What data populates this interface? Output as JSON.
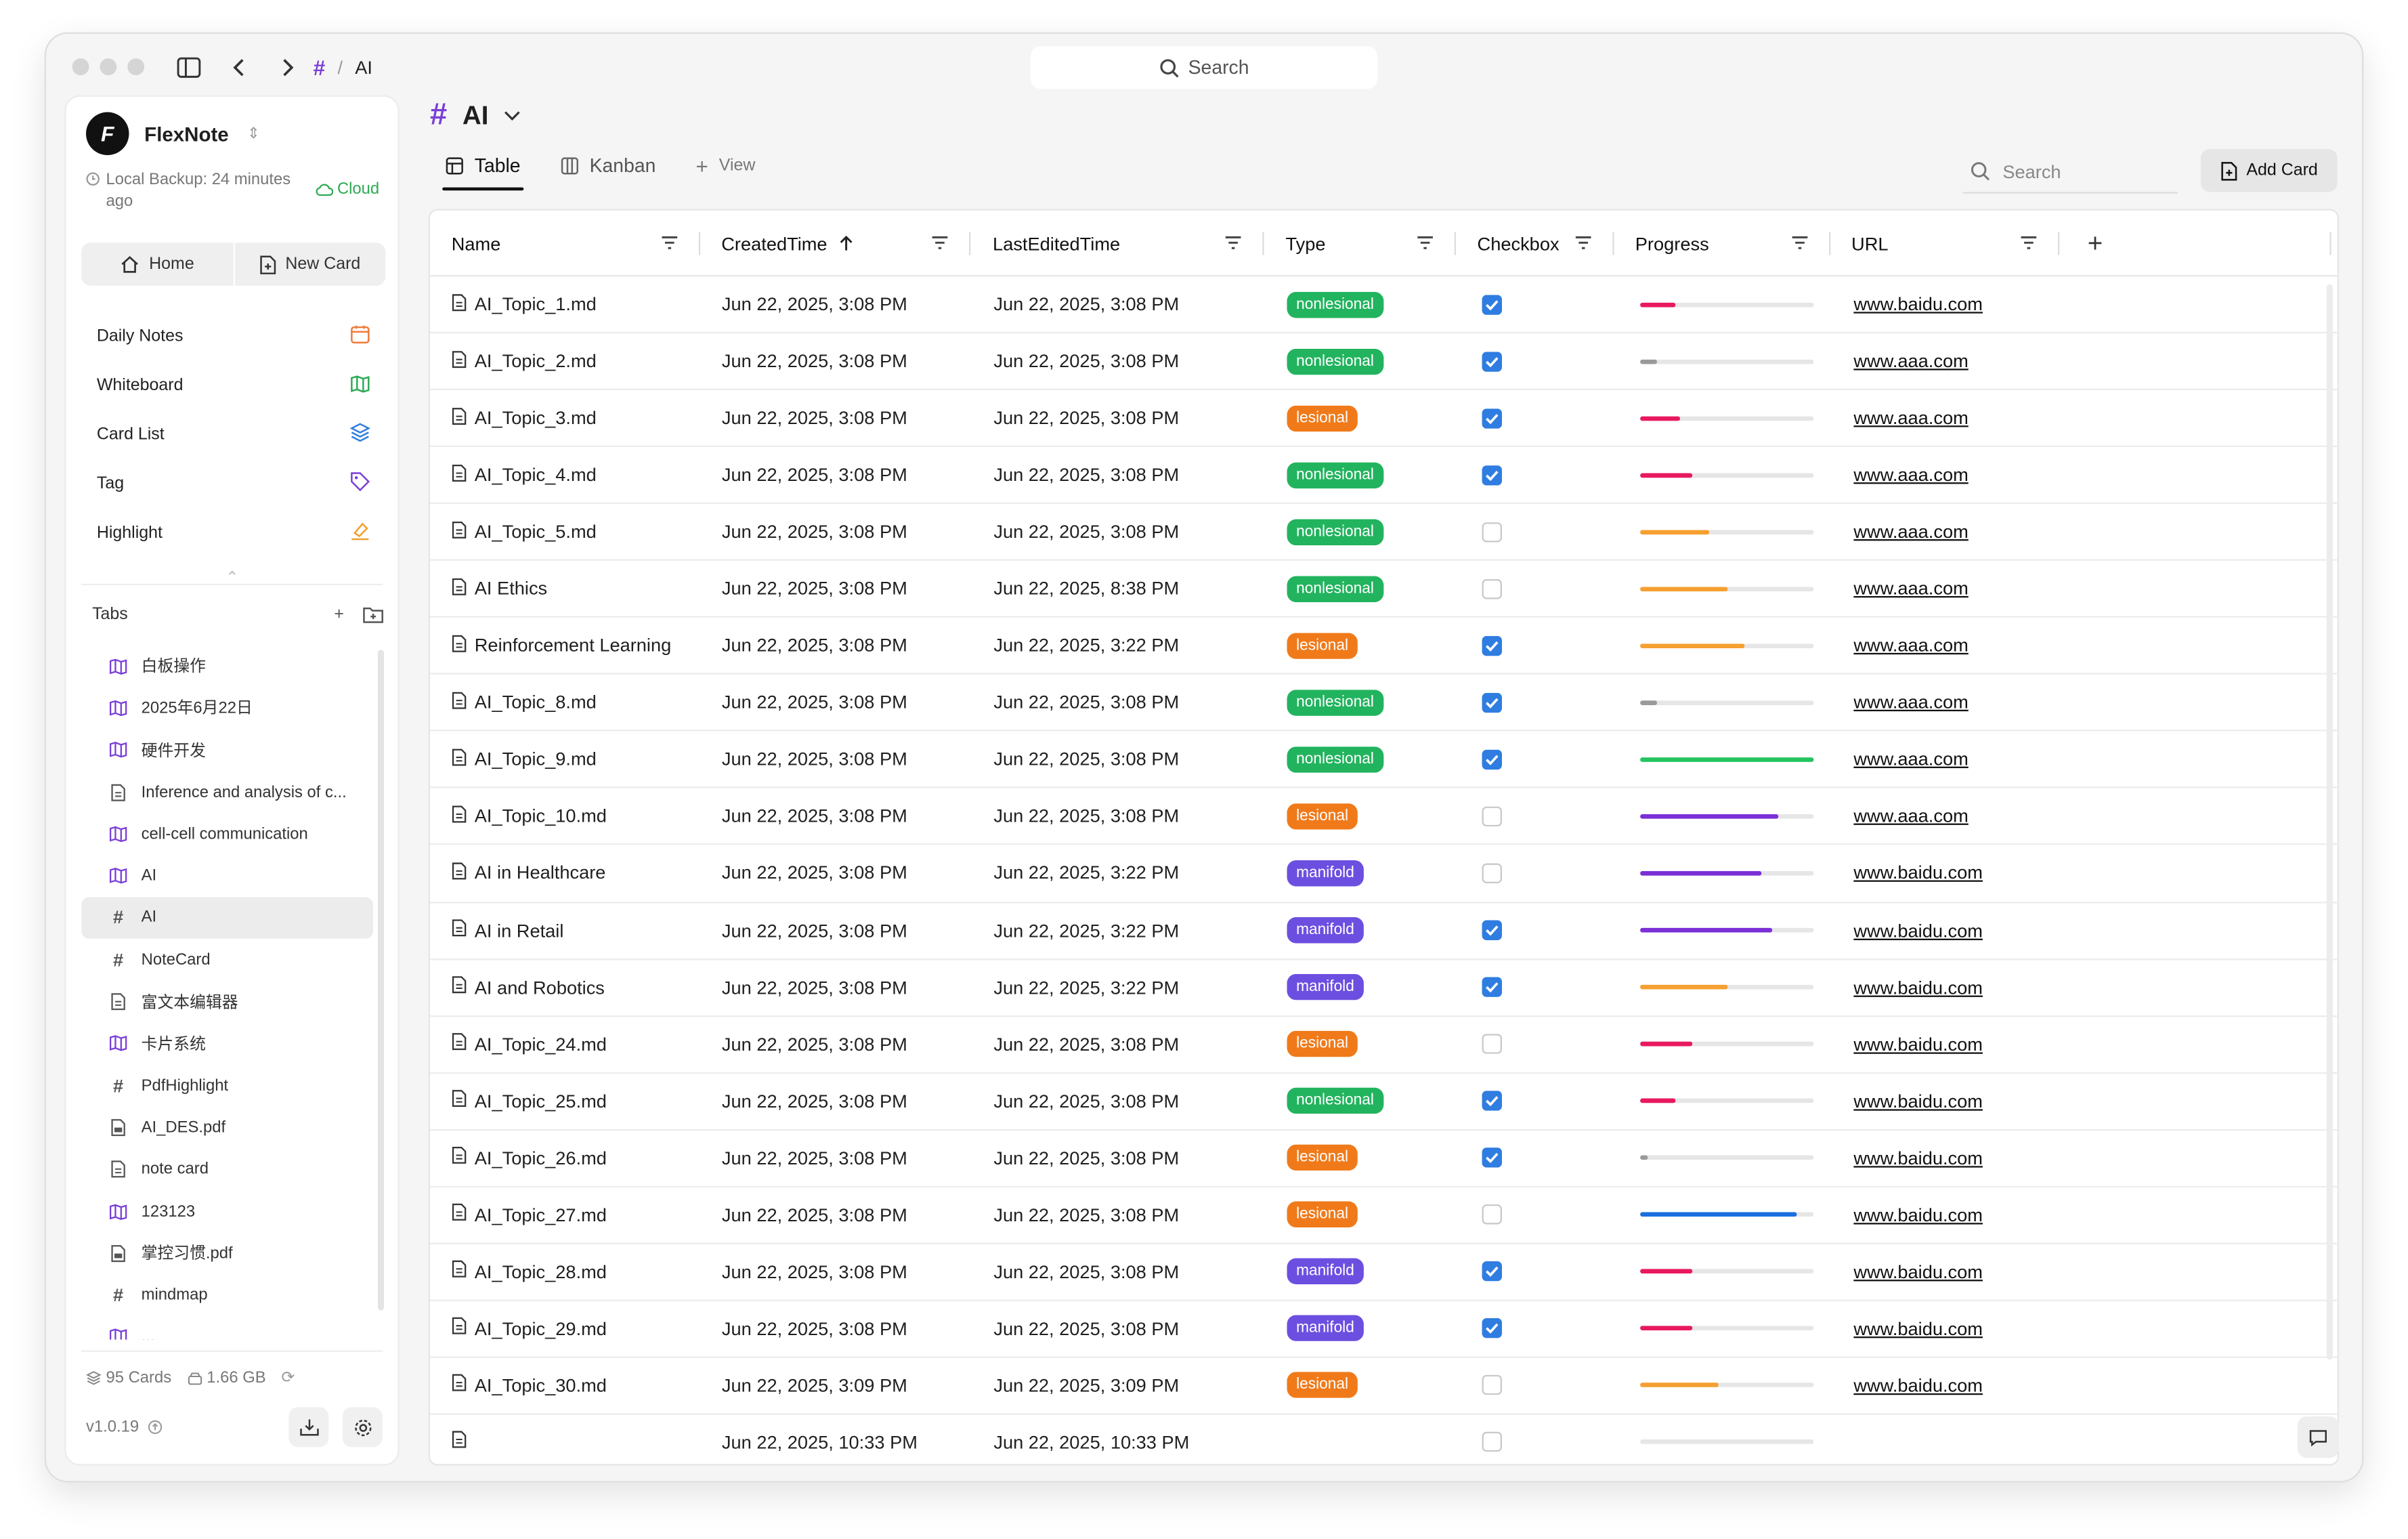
{
  "titlebar": {
    "breadcrumb_hash": "#",
    "breadcrumb_sep": "/",
    "breadcrumb_current": "AI",
    "search_placeholder": "Search"
  },
  "sidebar": {
    "brand": "FlexNote",
    "backup_text": "Local Backup: 24 minutes ago",
    "cloud_label": "Cloud",
    "home_label": "Home",
    "new_card_label": "New Card",
    "nav": [
      {
        "label": "Daily Notes",
        "icon": "calendar-icon",
        "color": "#f07a3a"
      },
      {
        "label": "Whiteboard",
        "icon": "map-icon",
        "color": "#2eaa55"
      },
      {
        "label": "Card List",
        "icon": "layers-icon",
        "color": "#2f7de1"
      },
      {
        "label": "Tag",
        "icon": "tag-icon",
        "color": "#7b3fd6"
      },
      {
        "label": "Highlight",
        "icon": "highlighter-icon",
        "color": "#f0a030"
      }
    ],
    "tabs_label": "Tabs",
    "tabs": [
      {
        "label": "白板操作",
        "icon": "map-icon"
      },
      {
        "label": "2025年6月22日",
        "icon": "map-icon"
      },
      {
        "label": "硬件开发",
        "icon": "map-icon"
      },
      {
        "label": "Inference and analysis of c...",
        "icon": "doc-icon"
      },
      {
        "label": "cell-cell communication",
        "icon": "map-icon"
      },
      {
        "label": "AI",
        "icon": "map-icon"
      },
      {
        "label": "AI",
        "icon": "hash-icon",
        "active": true
      },
      {
        "label": "NoteCard",
        "icon": "hash-icon"
      },
      {
        "label": "富文本编辑器",
        "icon": "doc-icon"
      },
      {
        "label": "卡片系统",
        "icon": "map-icon"
      },
      {
        "label": "PdfHighlight",
        "icon": "hash-icon"
      },
      {
        "label": "AI_DES.pdf",
        "icon": "pdf-icon"
      },
      {
        "label": "note card",
        "icon": "doc-icon"
      },
      {
        "label": "123123",
        "icon": "map-icon"
      },
      {
        "label": "掌控习惯.pdf",
        "icon": "pdf-icon"
      },
      {
        "label": "mindmap",
        "icon": "hash-icon"
      },
      {
        "label": "...",
        "icon": "map-icon"
      }
    ],
    "cards_count": "95 Cards",
    "storage": "1.66 GB",
    "version": "v1.0.19"
  },
  "main": {
    "title": "AI",
    "views": [
      {
        "label": "Table",
        "icon": "table-icon",
        "active": true
      },
      {
        "label": "Kanban",
        "icon": "kanban-icon"
      },
      {
        "label": "View",
        "icon": "plus-icon"
      }
    ],
    "search_placeholder": "Search",
    "add_card_label": "Add Card"
  },
  "table": {
    "columns": [
      "Name",
      "CreatedTime",
      "LastEditedTime",
      "Type",
      "Checkbox",
      "Progress",
      "URL"
    ],
    "type_colors": {
      "nonlesional": "#22b35e",
      "lesional": "#f07a1a",
      "manifold": "#6c4fe0"
    },
    "rows": [
      {
        "name": "AI_Topic_1.md",
        "created": "Jun 22, 2025, 3:08 PM",
        "edited": "Jun 22, 2025, 3:08 PM",
        "type": "nonlesional",
        "checked": true,
        "progress": 0.2,
        "progress_color": "#e8195e",
        "url": "www.baidu.com"
      },
      {
        "name": "AI_Topic_2.md",
        "created": "Jun 22, 2025, 3:08 PM",
        "edited": "Jun 22, 2025, 3:08 PM",
        "type": "nonlesional",
        "checked": true,
        "progress": 0.1,
        "progress_color": "#9a9a9a",
        "url": "www.aaa.com"
      },
      {
        "name": "AI_Topic_3.md",
        "created": "Jun 22, 2025, 3:08 PM",
        "edited": "Jun 22, 2025, 3:08 PM",
        "type": "lesional",
        "checked": true,
        "progress": 0.23,
        "progress_color": "#e8195e",
        "url": "www.aaa.com"
      },
      {
        "name": "AI_Topic_4.md",
        "created": "Jun 22, 2025, 3:08 PM",
        "edited": "Jun 22, 2025, 3:08 PM",
        "type": "nonlesional",
        "checked": true,
        "progress": 0.3,
        "progress_color": "#e8195e",
        "url": "www.aaa.com"
      },
      {
        "name": "AI_Topic_5.md",
        "created": "Jun 22, 2025, 3:08 PM",
        "edited": "Jun 22, 2025, 3:08 PM",
        "type": "nonlesional",
        "checked": false,
        "progress": 0.4,
        "progress_color": "#f5a030",
        "url": "www.aaa.com"
      },
      {
        "name": "AI Ethics",
        "created": "Jun 22, 2025, 3:08 PM",
        "edited": "Jun 22, 2025, 8:38 PM",
        "type": "nonlesional",
        "checked": false,
        "progress": 0.5,
        "progress_color": "#f5a030",
        "url": "www.aaa.com"
      },
      {
        "name": "Reinforcement Learning",
        "created": "Jun 22, 2025, 3:08 PM",
        "edited": "Jun 22, 2025, 3:22 PM",
        "type": "lesional",
        "checked": true,
        "progress": 0.6,
        "progress_color": "#f5a030",
        "url": "www.aaa.com"
      },
      {
        "name": "AI_Topic_8.md",
        "created": "Jun 22, 2025, 3:08 PM",
        "edited": "Jun 22, 2025, 3:08 PM",
        "type": "nonlesional",
        "checked": true,
        "progress": 0.1,
        "progress_color": "#9a9a9a",
        "url": "www.aaa.com"
      },
      {
        "name": "AI_Topic_9.md",
        "created": "Jun 22, 2025, 3:08 PM",
        "edited": "Jun 22, 2025, 3:08 PM",
        "type": "nonlesional",
        "checked": true,
        "progress": 1.0,
        "progress_color": "#22c55e",
        "url": "www.aaa.com"
      },
      {
        "name": "AI_Topic_10.md",
        "created": "Jun 22, 2025, 3:08 PM",
        "edited": "Jun 22, 2025, 3:08 PM",
        "type": "lesional",
        "checked": false,
        "progress": 0.8,
        "progress_color": "#7b2fd6",
        "url": "www.aaa.com"
      },
      {
        "name": "AI in Healthcare",
        "created": "Jun 22, 2025, 3:08 PM",
        "edited": "Jun 22, 2025, 3:22 PM",
        "type": "manifold",
        "checked": false,
        "progress": 0.7,
        "progress_color": "#7b2fd6",
        "url": "www.baidu.com"
      },
      {
        "name": "AI in Retail",
        "created": "Jun 22, 2025, 3:08 PM",
        "edited": "Jun 22, 2025, 3:22 PM",
        "type": "manifold",
        "checked": true,
        "progress": 0.76,
        "progress_color": "#7b2fd6",
        "url": "www.baidu.com"
      },
      {
        "name": "AI and Robotics",
        "created": "Jun 22, 2025, 3:08 PM",
        "edited": "Jun 22, 2025, 3:22 PM",
        "type": "manifold",
        "checked": true,
        "progress": 0.5,
        "progress_color": "#f5a030",
        "url": "www.baidu.com"
      },
      {
        "name": "AI_Topic_24.md",
        "created": "Jun 22, 2025, 3:08 PM",
        "edited": "Jun 22, 2025, 3:08 PM",
        "type": "lesional",
        "checked": false,
        "progress": 0.3,
        "progress_color": "#e8195e",
        "url": "www.baidu.com"
      },
      {
        "name": "AI_Topic_25.md",
        "created": "Jun 22, 2025, 3:08 PM",
        "edited": "Jun 22, 2025, 3:08 PM",
        "type": "nonlesional",
        "checked": true,
        "progress": 0.2,
        "progress_color": "#e8195e",
        "url": "www.baidu.com"
      },
      {
        "name": "AI_Topic_26.md",
        "created": "Jun 22, 2025, 3:08 PM",
        "edited": "Jun 22, 2025, 3:08 PM",
        "type": "lesional",
        "checked": true,
        "progress": 0.04,
        "progress_color": "#9a9a9a",
        "url": "www.baidu.com"
      },
      {
        "name": "AI_Topic_27.md",
        "created": "Jun 22, 2025, 3:08 PM",
        "edited": "Jun 22, 2025, 3:08 PM",
        "type": "lesional",
        "checked": false,
        "progress": 0.9,
        "progress_color": "#1a6fe0",
        "url": "www.baidu.com"
      },
      {
        "name": "AI_Topic_28.md",
        "created": "Jun 22, 2025, 3:08 PM",
        "edited": "Jun 22, 2025, 3:08 PM",
        "type": "manifold",
        "checked": true,
        "progress": 0.3,
        "progress_color": "#e8195e",
        "url": "www.baidu.com"
      },
      {
        "name": "AI_Topic_29.md",
        "created": "Jun 22, 2025, 3:08 PM",
        "edited": "Jun 22, 2025, 3:08 PM",
        "type": "manifold",
        "checked": true,
        "progress": 0.3,
        "progress_color": "#e8195e",
        "url": "www.baidu.com"
      },
      {
        "name": "AI_Topic_30.md",
        "created": "Jun 22, 2025, 3:09 PM",
        "edited": "Jun 22, 2025, 3:09 PM",
        "type": "lesional",
        "checked": false,
        "progress": 0.45,
        "progress_color": "#f5a030",
        "url": "www.baidu.com"
      },
      {
        "name": "",
        "created": "Jun 22, 2025, 10:33 PM",
        "edited": "Jun 22, 2025, 10:33 PM",
        "type": "",
        "checked": false,
        "progress": 0,
        "progress_color": "#9a9a9a",
        "url": ""
      }
    ]
  }
}
